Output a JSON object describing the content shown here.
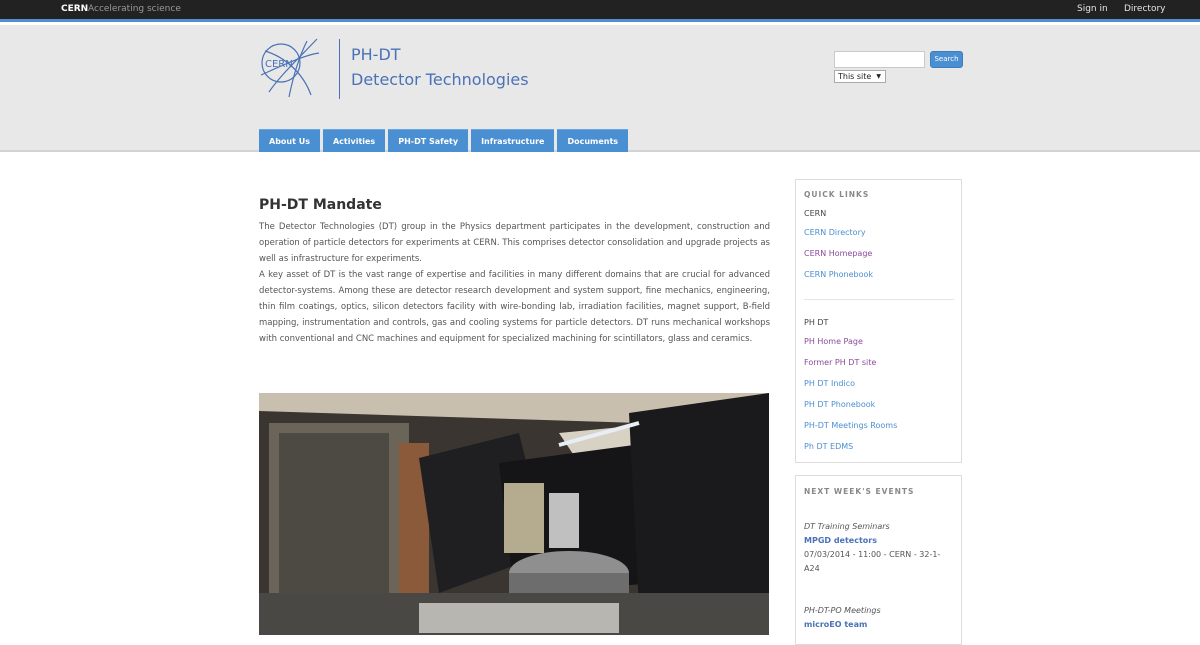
{
  "topbar": {
    "brand": "CERN",
    "tagline": "Accelerating science",
    "signin": "Sign in",
    "directory": "Directory"
  },
  "header": {
    "logo_text": "CERN",
    "site_code": "PH-DT",
    "site_name": "Detector Technologies"
  },
  "search": {
    "value": "",
    "button": "Search",
    "scope": "This site"
  },
  "nav": [
    "About Us",
    "Activities",
    "PH-DT Safety",
    "Infrastructure",
    "Documents"
  ],
  "main": {
    "title": "PH-DT Mandate",
    "paragraph1": "The Detector Technologies (DT) group in the Physics department participates in the development, construction and operation of particle detectors for experiments at CERN. This comprises detector consolidation and upgrade projects as well as infrastructure for experiments.",
    "paragraph2": "A key asset of DT is the vast range of expertise and facilities in many different domains that are crucial for advanced detector-systems. Among these are detector research development and system support, fine mechanics, engineering, thin film coatings, optics, silicon detectors facility with wire-bonding lab, irradiation facilities, magnet support, B-field mapping, instrumentation and controls, gas and cooling systems for particle detectors. DT runs mechanical workshops with conventional and CNC machines and equipment for specialized machining for scintillators, glass and ceramics."
  },
  "quick_links": {
    "heading": "QUICK LINKS",
    "group1_label": "CERN",
    "group1": [
      "CERN Directory",
      "CERN Homepage",
      "CERN Phonebook"
    ],
    "group2_label": "PH DT",
    "group2": [
      "PH Home Page",
      "Former PH DT site",
      "PH DT Indico",
      "PH DT Phonebook",
      "PH-DT Meetings Rooms",
      "Ph DT EDMS"
    ]
  },
  "events": {
    "heading": "NEXT WEEK'S EVENTS",
    "items": [
      {
        "series": "DT Training Seminars",
        "title": "MPGD detectors",
        "meta": "07/03/2014 - 11:00 - CERN - 32-1-A24"
      },
      {
        "series": "PH-DT-PO Meetings",
        "title": "microEO team"
      }
    ]
  },
  "colors": {
    "accent": "#4a8fd2",
    "brand_text": "#4a72b6",
    "topbar": "#222222",
    "visited_link": "#8a4a9d"
  }
}
